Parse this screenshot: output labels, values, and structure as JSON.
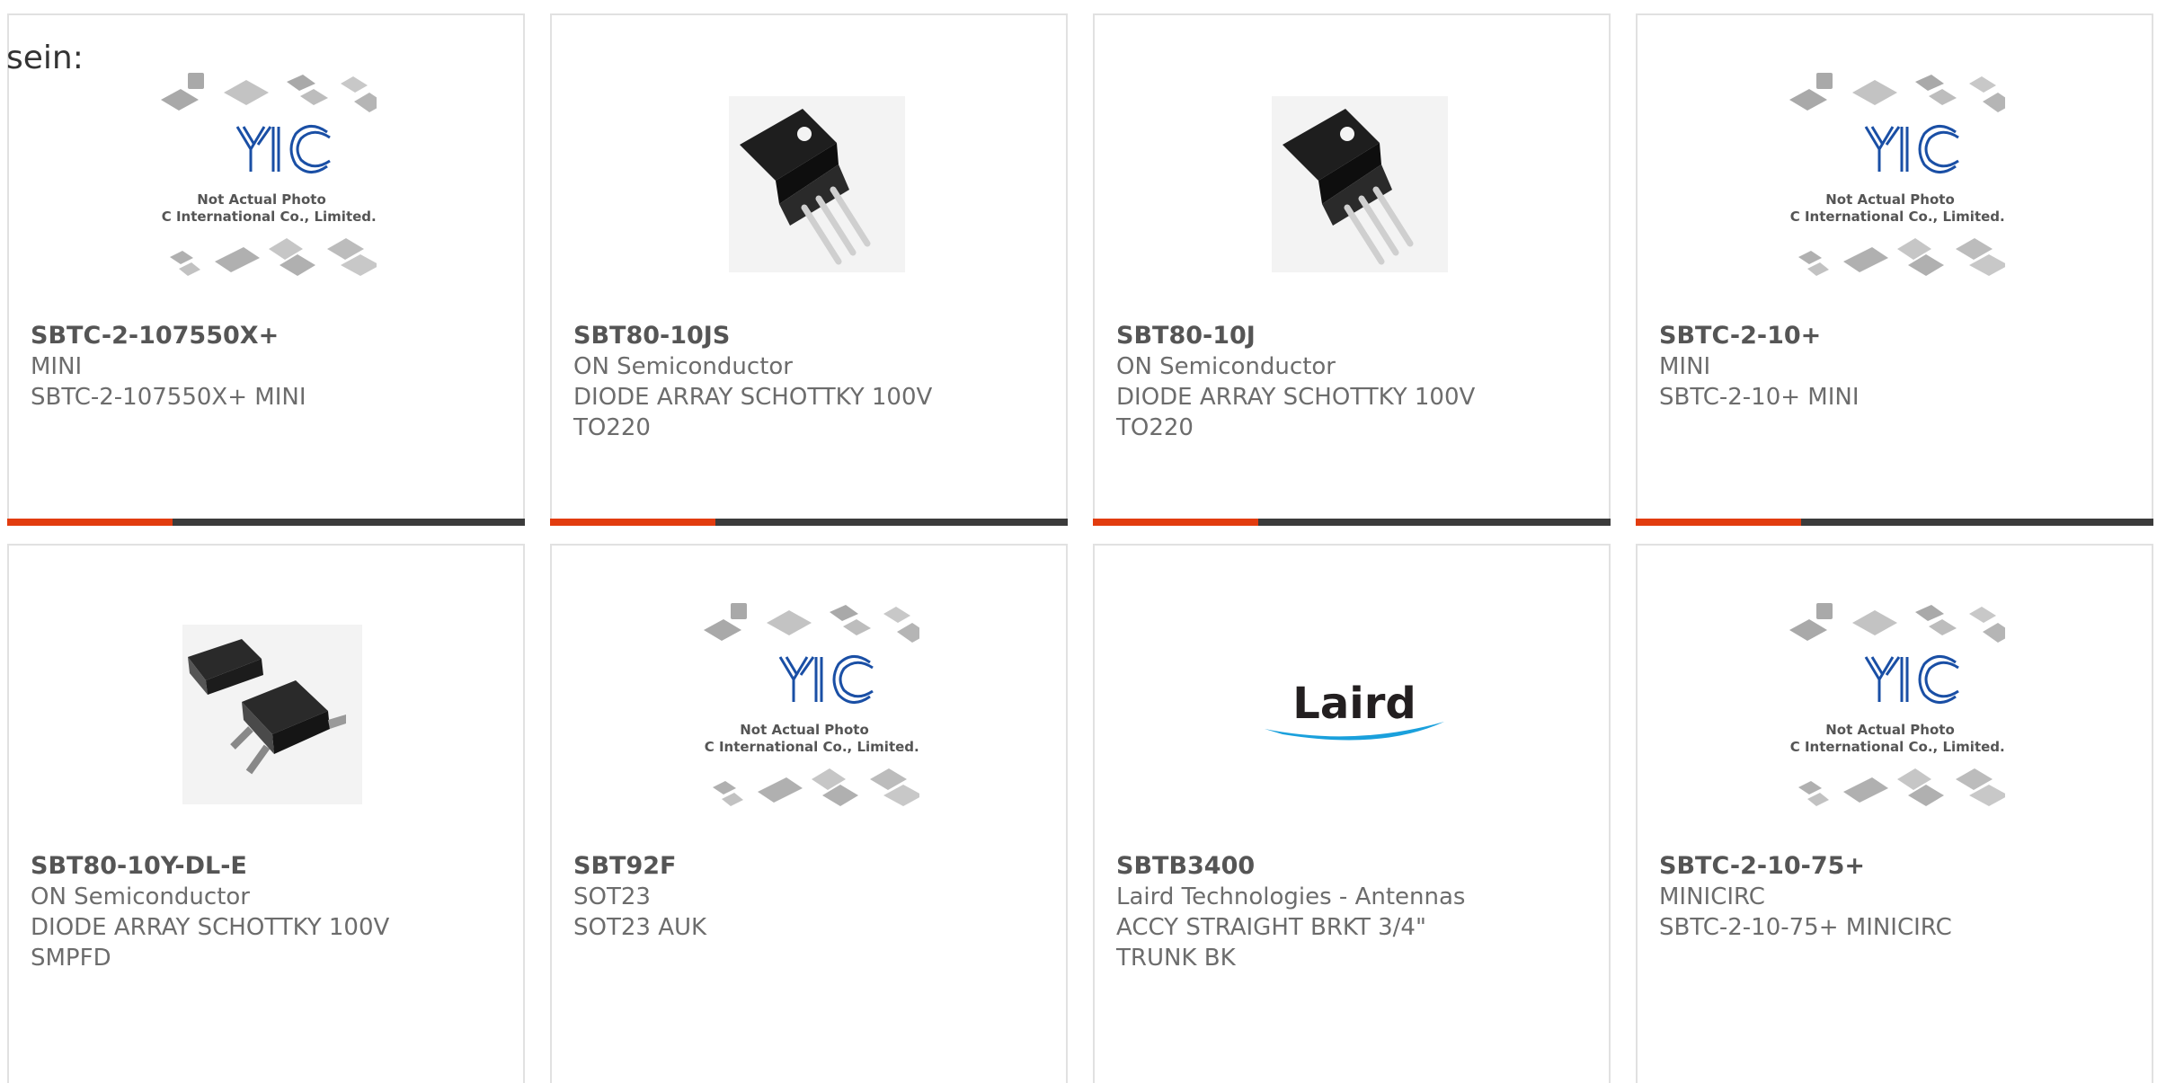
{
  "intro_text": "sein:",
  "watermark": {
    "line1": "Not Actual Photo",
    "line2": "YIC International Co., Limited."
  },
  "laird_logo_text": "Laird",
  "colors": {
    "accent": "#e23c0f",
    "bar_dark": "#3b3b3b",
    "logo_blue": "#1a4fa5",
    "laird_blue": "#1aa0dc"
  },
  "products": [
    {
      "part": "SBTC-2-107550X+",
      "lines": [
        "MINI",
        "SBTC-2-107550X+ MINI"
      ],
      "image": "placeholder-yic"
    },
    {
      "part": "SBT80-10JS",
      "lines": [
        "ON Semiconductor",
        "DIODE ARRAY SCHOTTKY 100V",
        "TO220"
      ],
      "image": "to220-package"
    },
    {
      "part": "SBT80-10J",
      "lines": [
        "ON Semiconductor",
        "DIODE ARRAY SCHOTTKY 100V",
        "TO220"
      ],
      "image": "to220-package"
    },
    {
      "part": "SBTC-2-10+",
      "lines": [
        "MINI",
        "SBTC-2-10+ MINI"
      ],
      "image": "placeholder-yic"
    },
    {
      "part": "SBT80-10Y-DL-E",
      "lines": [
        "ON Semiconductor",
        "DIODE ARRAY SCHOTTKY 100V",
        "SMPFD"
      ],
      "image": "dpak-package"
    },
    {
      "part": "SBT92F",
      "lines": [
        "SOT23",
        "SOT23 AUK"
      ],
      "image": "placeholder-yic"
    },
    {
      "part": "SBTB3400",
      "lines": [
        "Laird Technologies - Antennas",
        "ACCY STRAIGHT BRKT 3/4\"",
        "TRUNK BK"
      ],
      "image": "laird-logo"
    },
    {
      "part": "SBTC-2-10-75+",
      "lines": [
        "MINICIRC",
        "SBTC-2-10-75+ MINICIRC"
      ],
      "image": "placeholder-yic"
    }
  ]
}
